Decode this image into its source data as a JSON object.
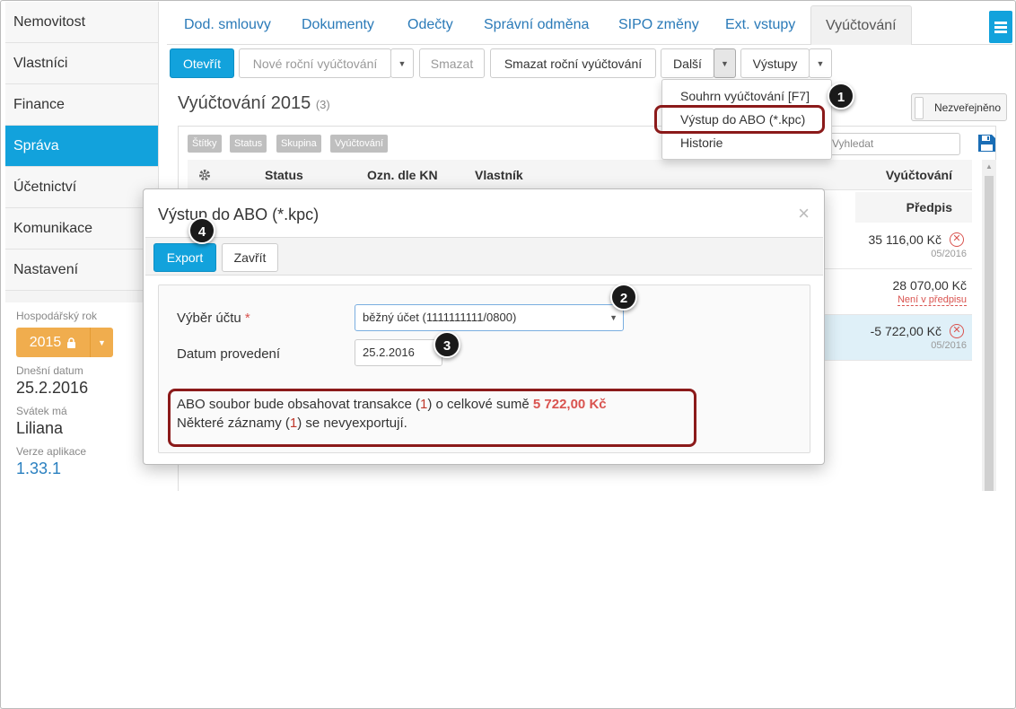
{
  "sidebar": {
    "items": [
      "Nemovitost",
      "Vlastníci",
      "Finance",
      "Správa",
      "Účetnictví",
      "Komunikace",
      "Nastavení"
    ],
    "active_index": 3,
    "fiscal_year_label": "Hospodářský rok",
    "fiscal_year": "2015",
    "today_label": "Dnešní datum",
    "today": "25.2.2016",
    "nameday_label": "Svátek má",
    "nameday": "Liliana",
    "version_label": "Verze aplikace",
    "version": "1.33.1"
  },
  "tabs": [
    "Dod. smlouvy",
    "Dokumenty",
    "Odečty",
    "Správní odměna",
    "SIPO změny",
    "Ext. vstupy",
    "Vyúčtování"
  ],
  "active_tab": "Vyúčtování",
  "toolbar": {
    "open": "Otevřít",
    "new_annual": "Nové roční vyúčtování",
    "delete": "Smazat",
    "delete_annual": "Smazat roční vyúčtování",
    "more": "Další",
    "outputs": "Výstupy"
  },
  "dropdown": {
    "items": [
      "Souhrn vyúčtování [F7]",
      "Výstup do ABO (*.kpc)",
      "Historie"
    ]
  },
  "content": {
    "title": "Vyúčtování 2015",
    "count": "(3)",
    "toggle": "Nezveřejněno",
    "chips": [
      "Štítky",
      "Status",
      "Skupina",
      "Vyúčtování"
    ],
    "search_placeholder": "Vyhledat",
    "columns": [
      "Status",
      "Ozn. dle KN",
      "Vlastník",
      "Vyúčtování"
    ],
    "subcolumn": "Předpis",
    "rows": [
      {
        "amount": "35 116,00 Kč",
        "sub": "05/2016",
        "error": true
      },
      {
        "amount": "28 070,00 Kč",
        "sub": "Není v předpisu",
        "error": false
      },
      {
        "amount": "-5 722,00 Kč",
        "sub": "05/2016",
        "error": true
      }
    ]
  },
  "modal": {
    "title": "Výstup do ABO (*.kpc)",
    "close": "×",
    "export": "Export",
    "cancel": "Zavřít",
    "account_label": "Výběr účtu",
    "required_mark": "*",
    "account_value": "běžný účet (1111111111/0800)",
    "date_label": "Datum provedení",
    "date_value": "25.2.2016",
    "msg_line1_a": "ABO soubor bude obsahovat transakce (",
    "msg_line1_n": "1",
    "msg_line1_b": ") o celkové sumě ",
    "msg_line1_sum": "5 722,00 Kč",
    "msg_line2_a": "Některé záznamy (",
    "msg_line2_n": "1",
    "msg_line2_b": ") se nevyexportují."
  },
  "badges": [
    "1",
    "2",
    "3",
    "4"
  ],
  "colors": {
    "accent": "#12a2dc",
    "warning": "#f0ad4e",
    "callout": "#8b1a1a",
    "error": "#d9534f"
  }
}
